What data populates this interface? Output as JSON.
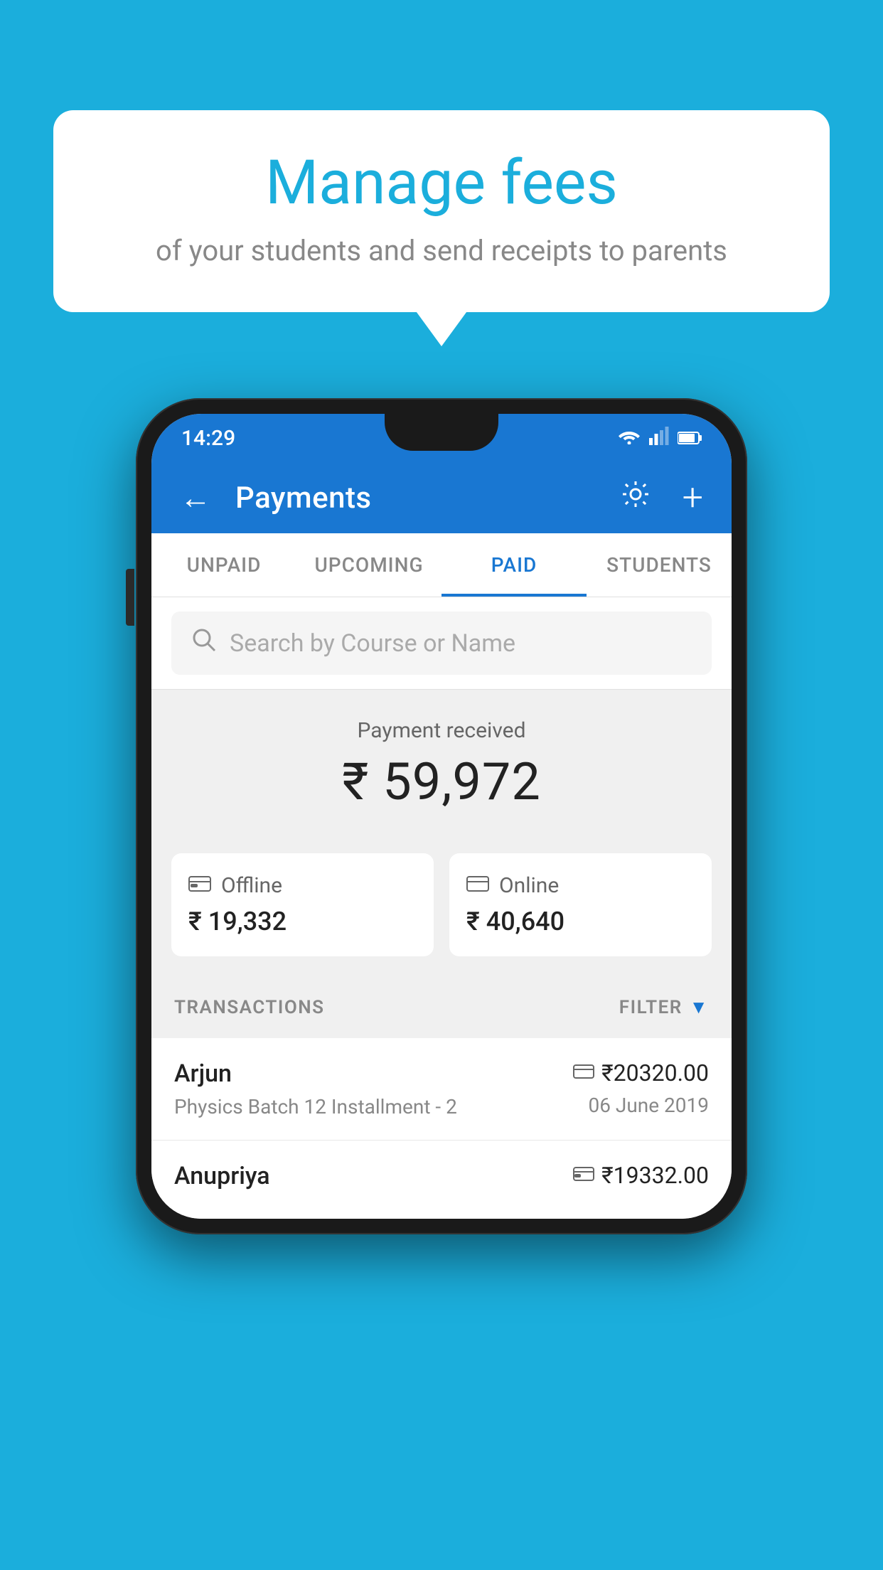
{
  "background_color": "#1BAEDC",
  "bubble": {
    "title": "Manage fees",
    "subtitle": "of your students and send receipts to parents"
  },
  "status_bar": {
    "time": "14:29",
    "wifi": "▲",
    "signal": "▲",
    "battery": "▌"
  },
  "app_bar": {
    "title": "Payments",
    "back_label": "←",
    "gear_label": "⚙",
    "plus_label": "+"
  },
  "tabs": [
    {
      "label": "UNPAID",
      "active": false
    },
    {
      "label": "UPCOMING",
      "active": false
    },
    {
      "label": "PAID",
      "active": true
    },
    {
      "label": "STUDENTS",
      "active": false
    }
  ],
  "search": {
    "placeholder": "Search by Course or Name"
  },
  "payment_summary": {
    "received_label": "Payment received",
    "amount": "₹ 59,972",
    "offline_label": "Offline",
    "offline_amount": "₹ 19,332",
    "online_label": "Online",
    "online_amount": "₹ 40,640"
  },
  "transactions_section": {
    "label": "TRANSACTIONS",
    "filter_label": "FILTER"
  },
  "transactions": [
    {
      "name": "Arjun",
      "detail": "Physics Batch 12 Installment - 2",
      "amount": "₹20320.00",
      "date": "06 June 2019",
      "payment_type": "online"
    },
    {
      "name": "Anupriya",
      "detail": "",
      "amount": "₹19332.00",
      "date": "",
      "payment_type": "offline"
    }
  ]
}
